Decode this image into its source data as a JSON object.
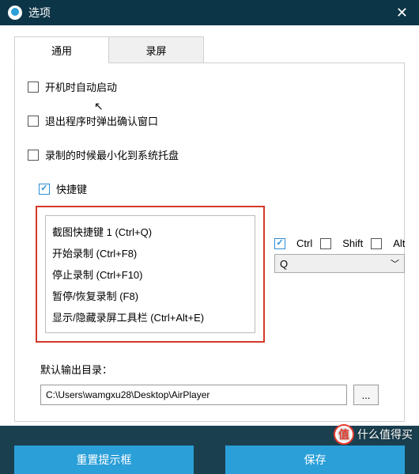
{
  "titlebar": {
    "title": "选项"
  },
  "tabs": {
    "general": "通用",
    "record": "录屏"
  },
  "options": {
    "autostart": "开机时自动启动",
    "confirm_on_exit": "退出程序时弹出确认窗口",
    "minimize_on_record": "录制的时候最小化到系统托盘",
    "hotkeys": "快捷键"
  },
  "shortcuts": [
    "截图快捷键 1 (Ctrl+Q)",
    "开始录制 (Ctrl+F8)",
    "停止录制 (Ctrl+F10)",
    "暂停/恢复录制 (F8)",
    "显示/隐藏录屏工具栏 (Ctrl+Alt+E)"
  ],
  "modifiers": {
    "ctrl": "Ctrl",
    "shift": "Shift",
    "alt": "Alt",
    "key": "Q"
  },
  "output": {
    "label": "默认输出目录：",
    "path": "C:\\Users\\wamgxu28\\Desktop\\AirPlayer",
    "browse": "..."
  },
  "buttons": {
    "reset": "重置提示框",
    "save": "保存"
  },
  "watermark": {
    "icon": "值",
    "text": "什么值得买"
  }
}
